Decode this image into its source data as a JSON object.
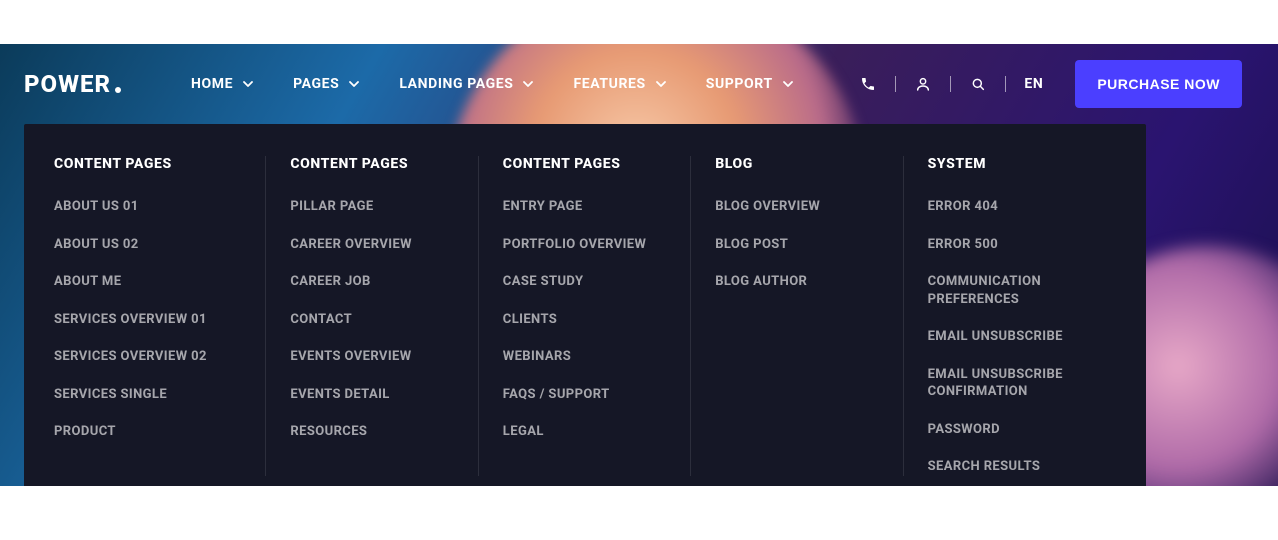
{
  "logo": "POWER",
  "nav": [
    {
      "label": "HOME"
    },
    {
      "label": "PAGES"
    },
    {
      "label": "LANDING PAGES"
    },
    {
      "label": "FEATURES"
    },
    {
      "label": "SUPPORT"
    }
  ],
  "lang": "EN",
  "cta": "PURCHASE NOW",
  "mega": [
    {
      "heading": "CONTENT PAGES",
      "items": [
        "ABOUT US 01",
        "ABOUT US 02",
        "ABOUT ME",
        "SERVICES OVERVIEW 01",
        "SERVICES OVERVIEW 02",
        "SERVICES SINGLE",
        "PRODUCT"
      ]
    },
    {
      "heading": "CONTENT PAGES",
      "items": [
        "PILLAR PAGE",
        "CAREER OVERVIEW",
        "CAREER JOB",
        "CONTACT",
        "EVENTS OVERVIEW",
        "EVENTS DETAIL",
        "RESOURCES"
      ]
    },
    {
      "heading": "CONTENT PAGES",
      "items": [
        "ENTRY PAGE",
        "PORTFOLIO OVERVIEW",
        "CASE STUDY",
        "CLIENTS",
        "WEBINARS",
        "FAQS / SUPPORT",
        "LEGAL"
      ]
    },
    {
      "heading": "BLOG",
      "items": [
        "BLOG OVERVIEW",
        "BLOG POST",
        "BLOG AUTHOR"
      ]
    },
    {
      "heading": "SYSTEM",
      "items": [
        "ERROR 404",
        "ERROR 500",
        "COMMUNICATION PREFERENCES",
        "EMAIL UNSUBSCRIBE",
        "EMAIL UNSUBSCRIBE CONFIRMATION",
        "PASSWORD",
        "SEARCH RESULTS"
      ]
    }
  ]
}
